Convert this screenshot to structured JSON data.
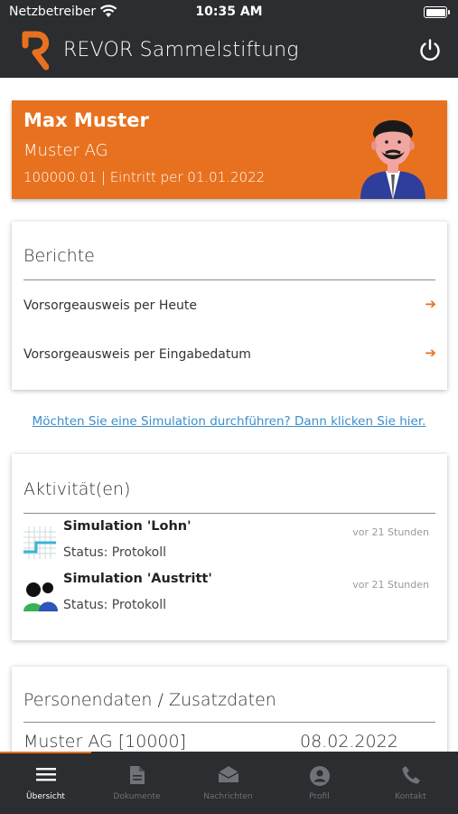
{
  "status_bar": {
    "carrier": "Netzbetreiber",
    "time": "10:35 AM"
  },
  "app": {
    "title": "REVOR Sammelstiftung",
    "logo_icon": "revor-logo-icon",
    "logout_icon": "power-icon",
    "brand_color": "#e8711f",
    "bar_color": "#2b2d30"
  },
  "profile": {
    "name": "Max Muster",
    "company": "Muster AG",
    "meta": "100000.01 | Eintritt per 01.01.2022",
    "avatar_icon": "avatar-icon"
  },
  "reports": {
    "title": "Berichte",
    "items": [
      {
        "label": "Vorsorgeausweis per Heute",
        "icon": "arrow-right-icon"
      },
      {
        "label": "Vorsorgeausweis per Eingabedatum",
        "icon": "arrow-right-icon"
      }
    ]
  },
  "simulation_link": "Möchten Sie eine Simulation durchführen? Dann klicken Sie hier.",
  "activities": {
    "title": "Aktivität(en)",
    "items": [
      {
        "title": "Simulation 'Lohn'",
        "status": "Status: Protokoll",
        "time": "vor 21 Stunden",
        "icon": "chart-icon"
      },
      {
        "title": "Simulation 'Austritt'",
        "status": "Status: Protokoll",
        "time": "vor 21 Stunden",
        "icon": "people-icon"
      }
    ]
  },
  "personal": {
    "title": "Personendaten / Zusatzdaten",
    "employer": "Muster AG [10000]",
    "date": "08.02.2022"
  },
  "tabs": [
    {
      "label": "Übersicht",
      "icon": "menu-icon",
      "active": true
    },
    {
      "label": "Dokumente",
      "icon": "document-icon",
      "active": false
    },
    {
      "label": "Nachrichten",
      "icon": "envelope-icon",
      "active": false
    },
    {
      "label": "Profil",
      "icon": "profile-icon",
      "active": false
    },
    {
      "label": "Kontakt",
      "icon": "phone-icon",
      "active": false
    }
  ]
}
